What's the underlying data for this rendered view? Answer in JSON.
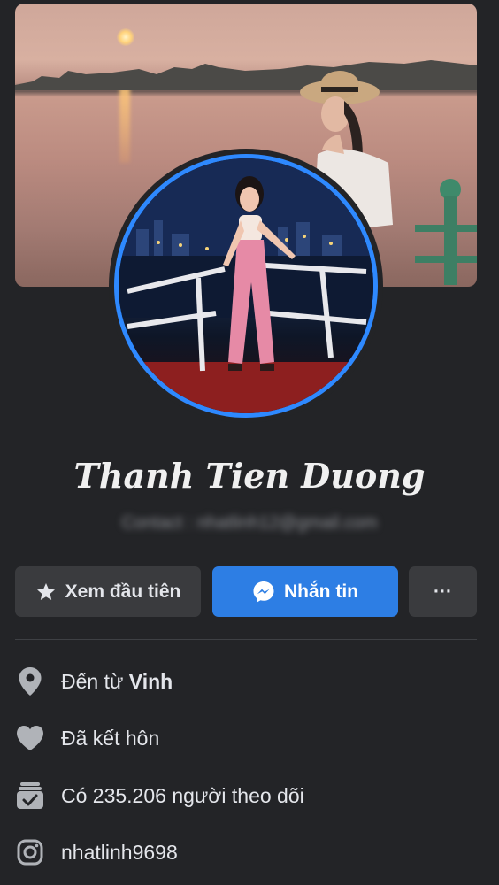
{
  "profile": {
    "name": "Thanh Tien Duong",
    "contact": "Contact : nhatlinh12@gmail.com"
  },
  "actions": {
    "follow_first_label": "Xem đầu tiên",
    "message_label": "Nhắn tin",
    "more_label": "···"
  },
  "intro": {
    "hometown_prefix": "Đến từ ",
    "hometown_city": "Vinh",
    "relationship": "Đã kết hôn",
    "followers": "Có 235.206 người theo dõi",
    "instagram": "nhatlinh9698"
  },
  "icons": [
    "star-icon",
    "messenger-icon",
    "more-icon",
    "location-pin-icon",
    "heart-icon",
    "followers-icon",
    "instagram-icon"
  ],
  "colors": {
    "background": "#232427",
    "accent": "#2d7ee4",
    "avatar_ring": "#2e89ff",
    "button_secondary": "#3a3b3e"
  }
}
